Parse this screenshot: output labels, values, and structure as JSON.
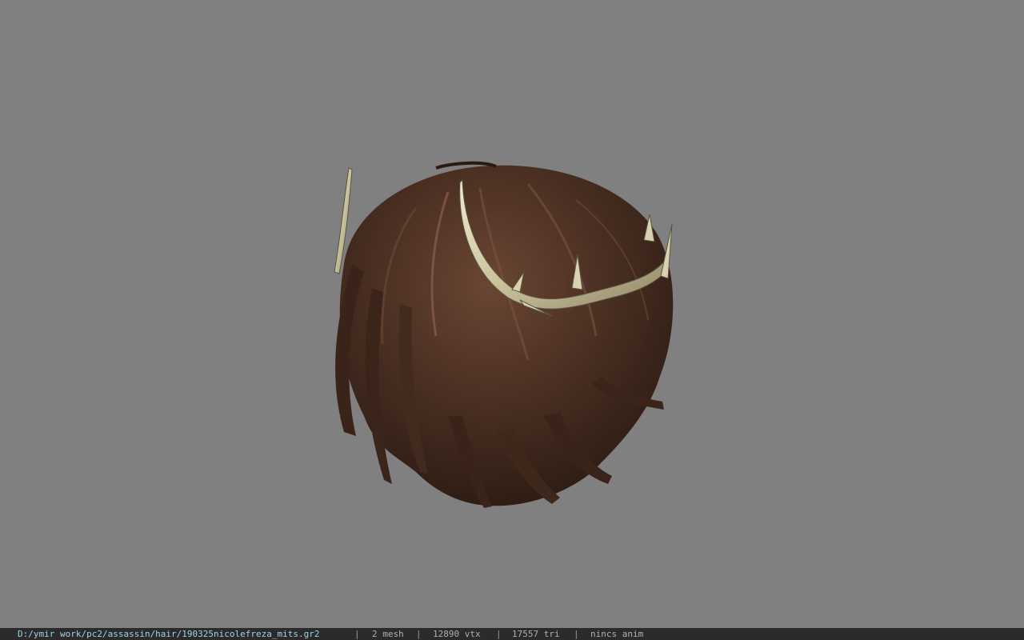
{
  "viewer": {
    "background_color": "#808080",
    "model": {
      "subject": "hair-with-thorn-tiara",
      "hair_color": "#4a2f22",
      "tiara_color": "#d8d2b0"
    }
  },
  "status_bar": {
    "file_path": "D:/ymir work/pc2/assassin/hair/190325nicolefreza_mits.gr2",
    "separator": "|",
    "mesh_count": "2 mesh",
    "vertex_count": "12890 vtx",
    "triangle_count": "17557 tri",
    "animation": "nincs anim",
    "colors": {
      "background": "#2b2b2b",
      "path_text": "#9fd3e6",
      "text": "#b0b0b0"
    }
  }
}
